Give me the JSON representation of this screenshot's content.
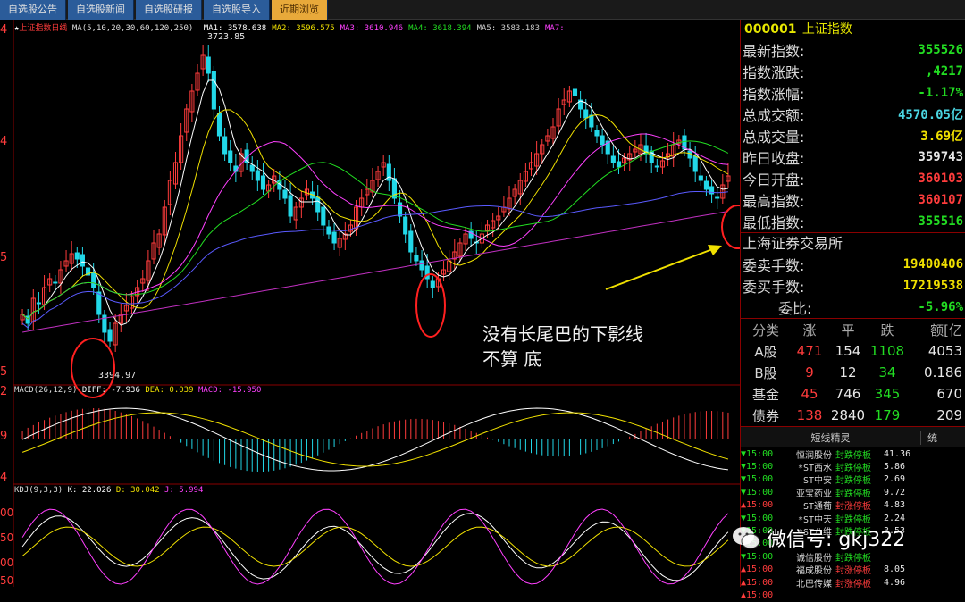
{
  "tabs": [
    {
      "label": "自选股公告",
      "active": false
    },
    {
      "label": "自选股新闻",
      "active": false
    },
    {
      "label": "自选股研报",
      "active": false
    },
    {
      "label": "自选股导入",
      "active": false
    },
    {
      "label": "近期浏览",
      "active": true
    }
  ],
  "main_chart": {
    "title": "上证指数日线",
    "ma_header": "MA(5,10,20,30,60,120,250)",
    "ma_values": [
      {
        "label": "MA1: 3578.638",
        "color": "#ffffff"
      },
      {
        "label": "MA2: 3596.575",
        "color": "#f0e000"
      },
      {
        "label": "MA3: 3610.946",
        "color": "#ff40ff"
      },
      {
        "label": "MA4: 3618.394",
        "color": "#22dd22"
      },
      {
        "label": "MA5: 3583.183",
        "color": "#cccccc"
      },
      {
        "label": "MA7:",
        "color": "#ff40ff"
      }
    ],
    "high_label": "3723.85",
    "low_label": "3394.97",
    "axis_labels": [
      "4",
      "4",
      "5",
      "5"
    ]
  },
  "macd_panel": {
    "title": "MACD(26,12,9)",
    "diff": "DIFF: -7.936",
    "dea": "DEA: 0.039",
    "macd": "MACD: -15.950",
    "axis_labels": [
      "2",
      "9",
      "4"
    ]
  },
  "kdj_panel": {
    "title": "KDJ(9,3,3)",
    "k": "K: 22.026",
    "d": "D: 30.042",
    "j": "J: 5.994",
    "axis_labels": [
      "00",
      "50",
      "00",
      "50"
    ]
  },
  "quote": {
    "code": "000001",
    "name": "上证指数",
    "rows": [
      {
        "label": "最新指数:",
        "value": "355526",
        "color": "green"
      },
      {
        "label": "指数涨跌:",
        "value": ",4217",
        "color": "green"
      },
      {
        "label": "指数涨幅:",
        "value": "-1.17%",
        "color": "green"
      },
      {
        "label": "总成交额:",
        "value": "4570.05亿",
        "color": "cyan"
      },
      {
        "label": "总成交量:",
        "value": "3.69亿",
        "color": "yellow"
      },
      {
        "label": "昨日收盘:",
        "value": "359743",
        "color": "white"
      },
      {
        "label": "今日开盘:",
        "value": "360103",
        "color": "red"
      },
      {
        "label": "最高指数:",
        "value": "360107",
        "color": "red"
      },
      {
        "label": "最低指数:",
        "value": "355516",
        "color": "green"
      }
    ],
    "exchange": "上海证券交易所",
    "rows2": [
      {
        "label": "委卖手数:",
        "value": "19400406",
        "color": "yellow"
      },
      {
        "label": "委买手数:",
        "value": "17219538",
        "color": "yellow"
      },
      {
        "label": "委比:",
        "value": "-5.96%",
        "color": "green"
      }
    ],
    "board_header": [
      "分类",
      "涨",
      "平",
      "跌",
      "额[亿"
    ],
    "boards": [
      {
        "name": "A股",
        "up": "471",
        "flat": "154",
        "down": "1108",
        "amount": "4053"
      },
      {
        "name": "B股",
        "up": "9",
        "flat": "12",
        "down": "34",
        "amount": "0.186"
      },
      {
        "name": "基金",
        "up": "45",
        "flat": "746",
        "down": "345",
        "amount": "670"
      },
      {
        "name": "债券",
        "up": "138",
        "flat": "2840",
        "down": "179",
        "amount": "209"
      }
    ],
    "short_term_title": "短线精灵",
    "short_term_tab": "统"
  },
  "short_term": [
    {
      "arrow": "▼",
      "time": "15:00",
      "name": "恒润股份",
      "event": "封跌停板",
      "value": "41.36",
      "up": false
    },
    {
      "arrow": "▼",
      "time": "15:00",
      "name": "*ST西水",
      "event": "封跌停板",
      "value": "5.86",
      "up": false
    },
    {
      "arrow": "▼",
      "time": "15:00",
      "name": "ST中安",
      "event": "封跌停板",
      "value": "2.69",
      "up": false
    },
    {
      "arrow": "▼",
      "time": "15:00",
      "name": "亚宝药业",
      "event": "封跌停板",
      "value": "9.72",
      "up": false
    },
    {
      "arrow": "▲",
      "time": "15:00",
      "name": "ST通葡",
      "event": "封涨停板",
      "value": "4.83",
      "up": true
    },
    {
      "arrow": "▼",
      "time": "15:00",
      "name": "*ST中天",
      "event": "封跌停板",
      "value": "2.24",
      "up": false
    },
    {
      "arrow": "▼",
      "time": "15:00",
      "name": "*ST八维",
      "event": "封跌停板",
      "value": "3.53",
      "up": false
    },
    {
      "arrow": "▼",
      "time": "15:00",
      "name": "",
      "event": "",
      "value": "",
      "up": false
    },
    {
      "arrow": "▼",
      "time": "15:00",
      "name": "诚信股份",
      "event": "封跌停板",
      "value": "",
      "up": false
    },
    {
      "arrow": "▲",
      "time": "15:00",
      "name": "福成股份",
      "event": "封涨停板",
      "value": "8.05",
      "up": true
    },
    {
      "arrow": "▲",
      "time": "15:00",
      "name": "北巴传媒",
      "event": "封涨停板",
      "value": "4.96",
      "up": true
    },
    {
      "arrow": "▲",
      "time": "15:00",
      "name": "",
      "event": "",
      "value": "",
      "up": true
    }
  ],
  "annotation": {
    "line1": "没有长尾巴的下影线",
    "line2": "不算 底"
  },
  "watermark": "微信号: gkj322"
}
